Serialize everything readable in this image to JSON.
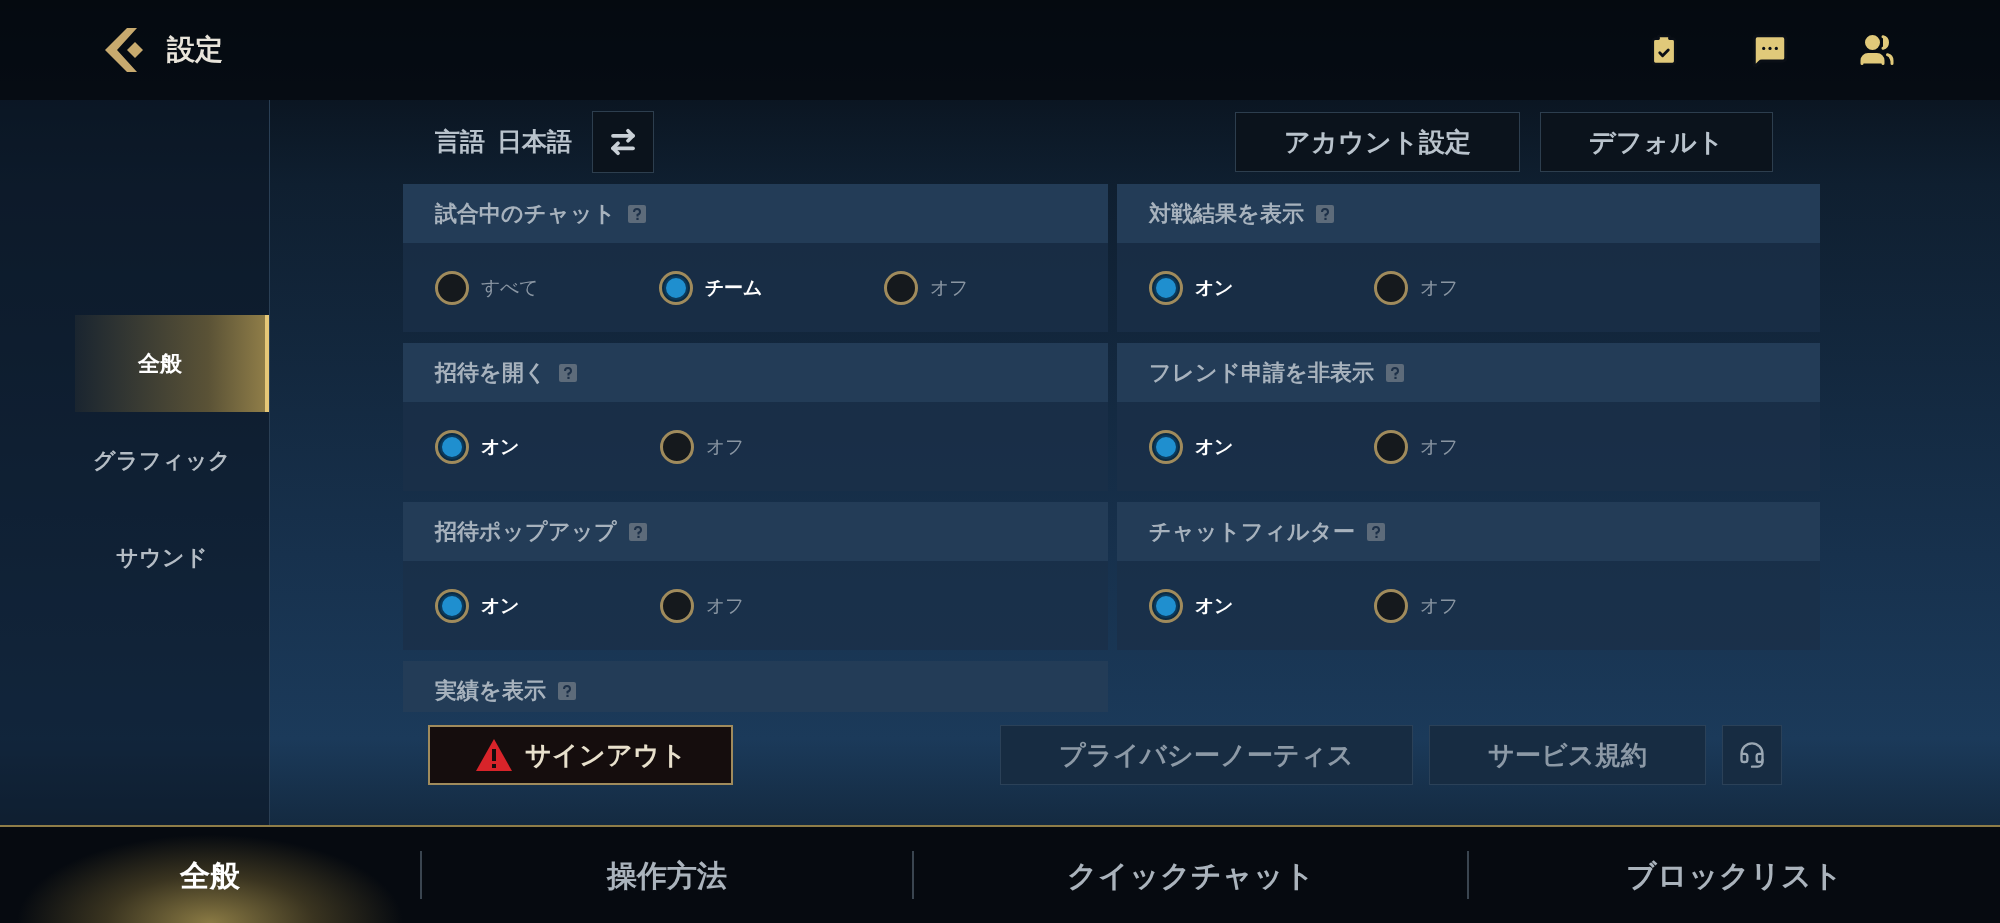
{
  "header": {
    "title": "設定"
  },
  "sidebar": {
    "items": [
      {
        "label": "全般",
        "selected": true
      },
      {
        "label": "グラフィック",
        "selected": false
      },
      {
        "label": "サウンド",
        "selected": false
      }
    ]
  },
  "language": {
    "label": "言語",
    "value": "日本語"
  },
  "top_buttons": [
    "アカウント設定",
    "デフォルト"
  ],
  "settings": [
    {
      "title": "試合中のチャット",
      "options": [
        {
          "label": "すべて",
          "selected": false
        },
        {
          "label": "チーム",
          "selected": true
        },
        {
          "label": "オフ",
          "selected": false
        }
      ]
    },
    {
      "title": "対戦結果を表示",
      "options": [
        {
          "label": "オン",
          "selected": true
        },
        {
          "label": "オフ",
          "selected": false
        }
      ]
    },
    {
      "title": "招待を開く",
      "options": [
        {
          "label": "オン",
          "selected": true
        },
        {
          "label": "オフ",
          "selected": false
        }
      ]
    },
    {
      "title": "フレンド申請を非表示",
      "options": [
        {
          "label": "オン",
          "selected": true
        },
        {
          "label": "オフ",
          "selected": false
        }
      ]
    },
    {
      "title": "招待ポップアップ",
      "options": [
        {
          "label": "オン",
          "selected": true
        },
        {
          "label": "オフ",
          "selected": false
        }
      ]
    },
    {
      "title": "チャットフィルター",
      "options": [
        {
          "label": "オン",
          "selected": true
        },
        {
          "label": "オフ",
          "selected": false
        }
      ]
    },
    {
      "title": "実績を表示"
    }
  ],
  "sign_out": "サインアウト",
  "links": [
    "プライバシーノーティス",
    "サービス規約"
  ],
  "bottom_tabs": [
    {
      "label": "全般",
      "selected": true
    },
    {
      "label": "操作方法",
      "selected": false
    },
    {
      "label": "クイックチャット",
      "selected": false
    },
    {
      "label": "ブロックリスト",
      "selected": false
    }
  ]
}
